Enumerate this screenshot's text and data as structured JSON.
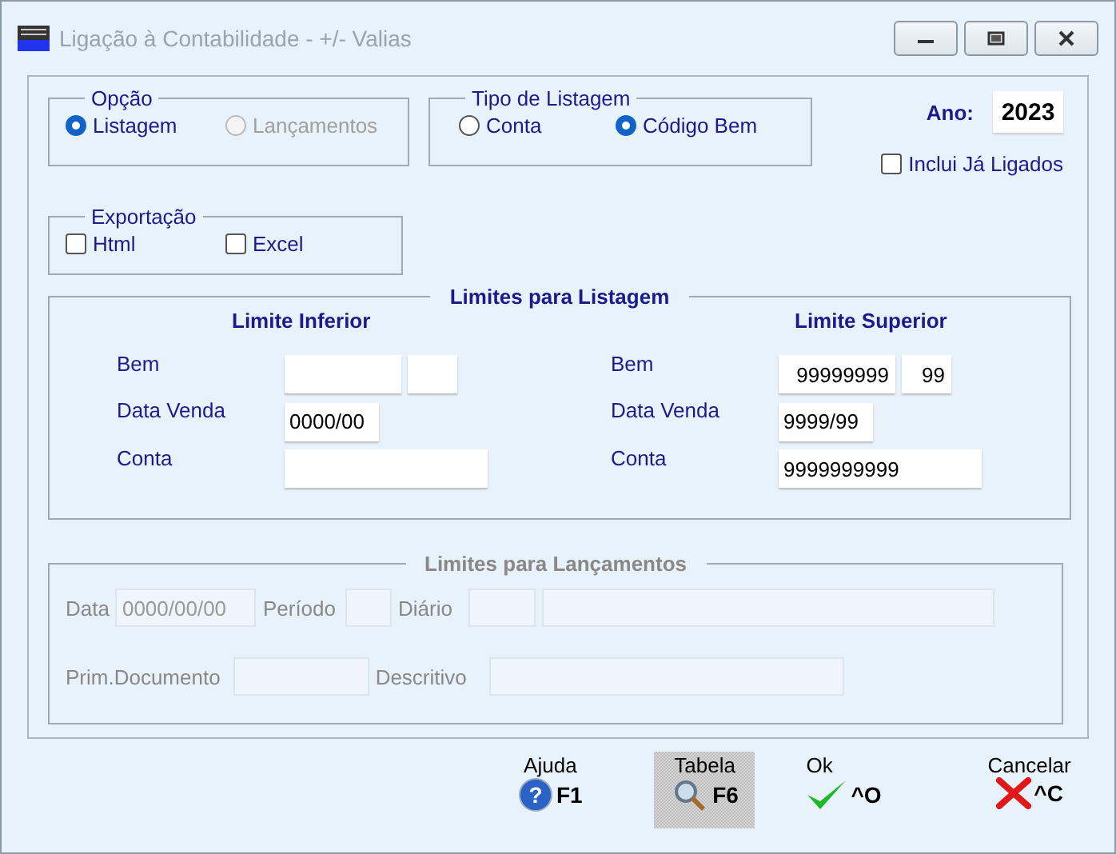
{
  "window": {
    "title": "Ligação à Contabilidade - +/- Valias"
  },
  "opcao": {
    "legend": "Opção",
    "options": [
      {
        "label": "Listagem",
        "selected": true,
        "disabled": false
      },
      {
        "label": "Lançamentos",
        "selected": false,
        "disabled": true
      }
    ]
  },
  "tipo": {
    "legend": "Tipo de Listagem",
    "options": [
      {
        "label": "Conta",
        "selected": false,
        "disabled": false
      },
      {
        "label": "Código Bem",
        "selected": true,
        "disabled": false
      }
    ]
  },
  "ano": {
    "label": "Ano:",
    "value": "2023"
  },
  "inclui": {
    "label": "Inclui Já Ligados",
    "checked": false
  },
  "exportacao": {
    "legend": "Exportação",
    "options": [
      {
        "label": "Html",
        "checked": false
      },
      {
        "label": "Excel",
        "checked": false
      }
    ]
  },
  "listagem": {
    "legend": "Limites para Listagem",
    "columns": [
      {
        "heading": "Limite Inferior",
        "rows": [
          {
            "label": "Bem",
            "fields": [
              {
                "kind": "code"
              },
              {
                "kind": "sub"
              }
            ]
          },
          {
            "label": "Data Venda",
            "fields": [
              {
                "kind": "date",
                "value": "0000/00"
              }
            ]
          },
          {
            "label": "Conta",
            "fields": [
              {
                "kind": "account"
              }
            ]
          }
        ]
      },
      {
        "heading": "Limite Superior",
        "rows": [
          {
            "label": "Bem",
            "fields": [
              {
                "kind": "code",
                "value": "99999999"
              },
              {
                "kind": "sub",
                "value": "99"
              }
            ]
          },
          {
            "label": "Data Venda",
            "fields": [
              {
                "kind": "date",
                "value": "9999/99"
              }
            ]
          },
          {
            "label": "Conta",
            "fields": [
              {
                "kind": "account",
                "value": "9999999999"
              }
            ]
          }
        ]
      }
    ]
  },
  "lancamentos": {
    "legend": "Limites para Lançamentos",
    "disabled": true,
    "rows": [
      {
        "fields": [
          {
            "label": "Data",
            "kind": "fulldate",
            "value": "0000/00/00"
          },
          {
            "label": "Período",
            "kind": "period"
          },
          {
            "label": "Diário",
            "kind": "journal"
          },
          {
            "kind": "journal_name"
          }
        ]
      },
      {
        "fields": [
          {
            "label": "Prim.Documento",
            "kind": "document"
          },
          {
            "label": "Descritivo",
            "kind": "description"
          }
        ]
      }
    ]
  },
  "buttons": [
    {
      "kind": "help",
      "label": "Ajuda",
      "key": "F1",
      "icon": "?"
    },
    {
      "kind": "table",
      "label": "Tabela",
      "key": "F6"
    },
    {
      "kind": "ok",
      "label": "Ok",
      "key": "^O"
    },
    {
      "kind": "cancel",
      "label": "Cancelar",
      "key": "^C"
    }
  ]
}
